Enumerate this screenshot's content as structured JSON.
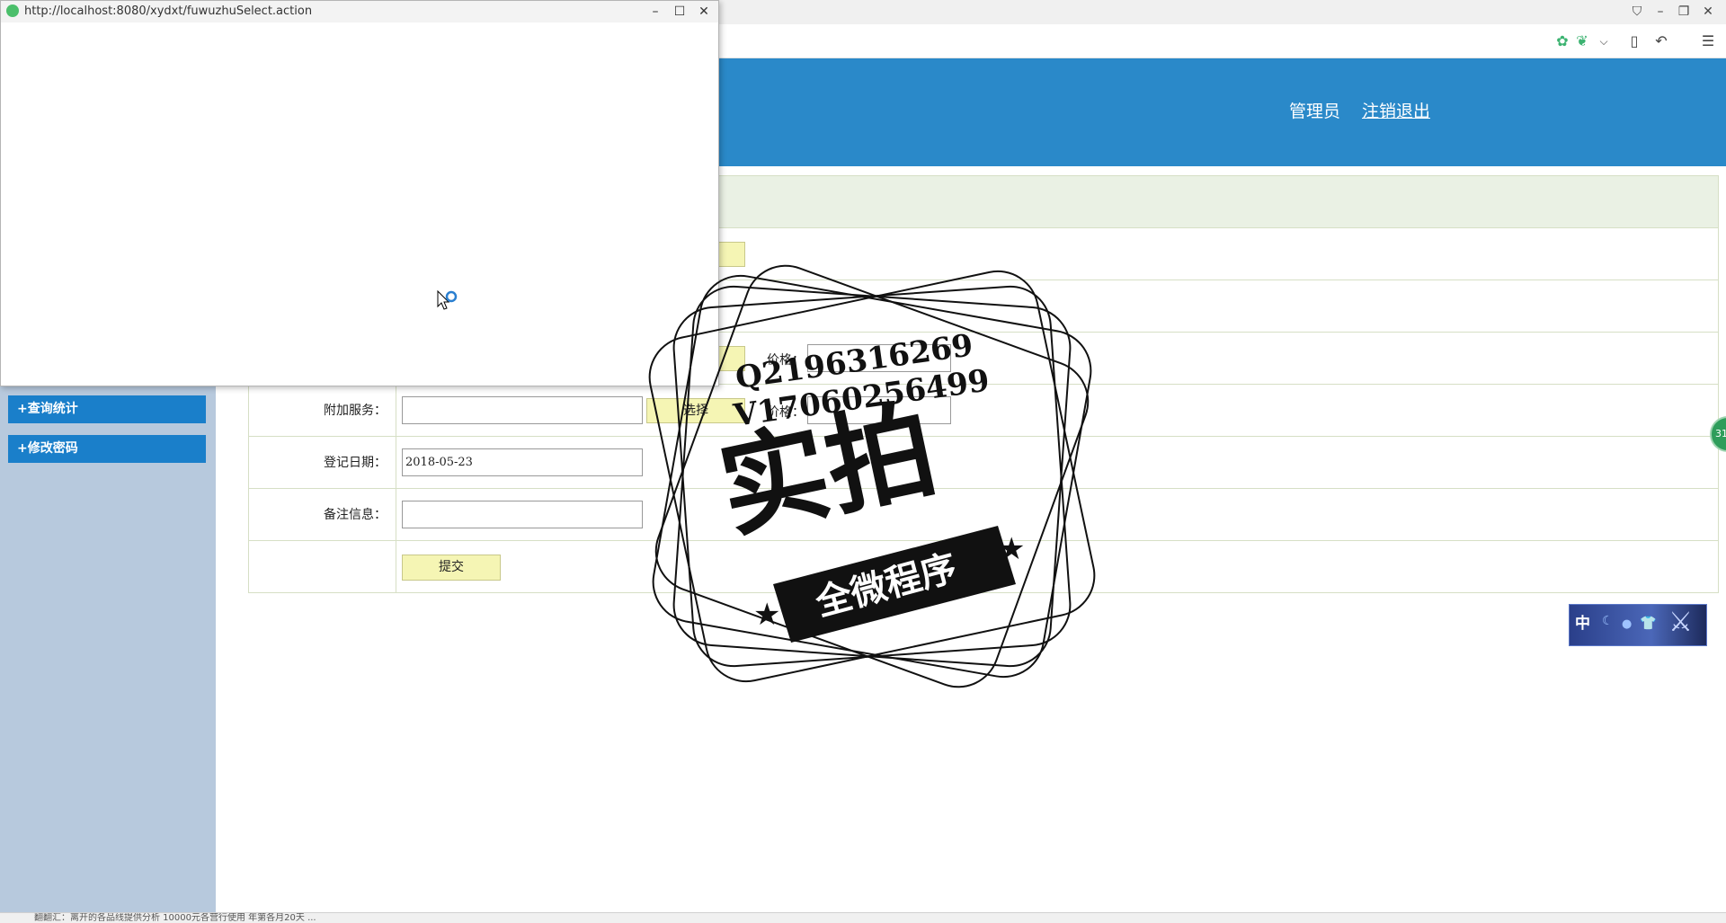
{
  "browser": {
    "popup_url": "http://localhost:8080/xydxt/fuwuzhuSelect.action"
  },
  "header": {
    "user_label": "管理员",
    "logout_label": "注销退出"
  },
  "sidebar": {
    "items": [
      {
        "label": "+查询统计"
      },
      {
        "label": "+修改密码"
      }
    ]
  },
  "form": {
    "rows": [
      {
        "label": "附加服务：",
        "value": "",
        "button": "选择",
        "price_label": "价格："
      },
      {
        "label": "登记日期：",
        "value": "2018-05-23"
      },
      {
        "label": "备注信息：",
        "value": ""
      }
    ],
    "upper_price_label": "价格：",
    "submit_label": "提交"
  },
  "widgets": {
    "ime_label": "中",
    "side_badge": "31"
  },
  "watermark": {
    "line1": "Q2196316269",
    "line2": "V17060256499",
    "main": "实拍",
    "banner": "全微程序"
  },
  "statusbar": {
    "text": "翻翻汇：离开的各品线提供分析 10000元各营行使用 年第各月20天 ..."
  },
  "colors": {
    "header_bg": "#2a89c9",
    "sidebar_bg": "#b7c9dd",
    "sidebar_button": "#1a7fca",
    "form_button": "#f5f5b4"
  }
}
